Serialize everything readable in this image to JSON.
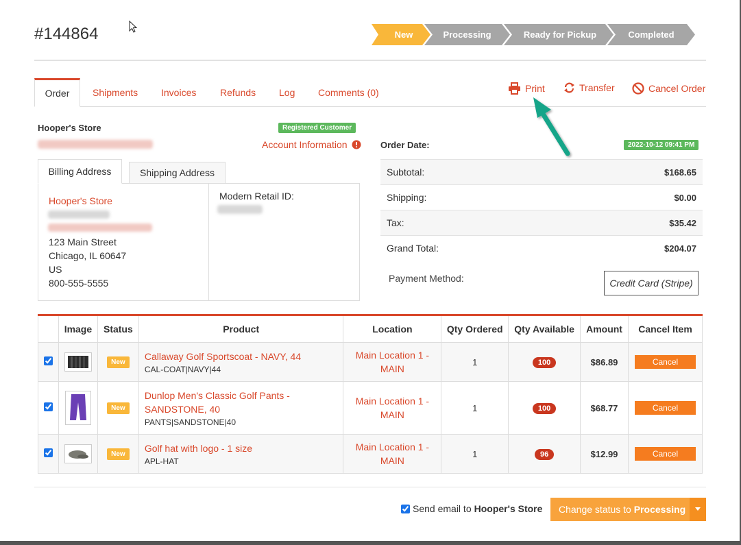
{
  "order": {
    "id": "#144864"
  },
  "steps": [
    {
      "label": "New",
      "state": "active",
      "color": "#f9b73a"
    },
    {
      "label": "Processing",
      "state": "pending",
      "color": "#a6a6a6"
    },
    {
      "label": "Ready for Pickup",
      "state": "pending",
      "color": "#a6a6a6"
    },
    {
      "label": "Completed",
      "state": "pending",
      "color": "#a6a6a6"
    }
  ],
  "tabs": [
    "Order",
    "Shipments",
    "Invoices",
    "Refunds",
    "Log",
    "Comments (0)"
  ],
  "actions": {
    "print": "Print",
    "transfer": "Transfer",
    "cancel": "Cancel Order"
  },
  "customer": {
    "store": "Hooper's Store",
    "badge": "Registered Customer",
    "account_info": "Account Information"
  },
  "address_tabs": [
    "Billing Address",
    "Shipping Address"
  ],
  "billing": {
    "name": "Hooper's Store",
    "street": "123 Main Street",
    "city": "Chicago, IL 60647",
    "country": "US",
    "phone": "800-555-5555",
    "retail_id_label": "Modern Retail ID:"
  },
  "summary": {
    "order_date_label": "Order Date:",
    "order_date": "2022-10-12 09:41 PM",
    "rows": [
      {
        "label": "Subtotal:",
        "value": "$168.65"
      },
      {
        "label": "Shipping:",
        "value": "$0.00"
      },
      {
        "label": "Tax:",
        "value": "$35.42"
      },
      {
        "label": "Grand Total:",
        "value": "$204.07"
      }
    ],
    "payment_label": "Payment Method:",
    "payment_value": "Credit Card (Stripe)"
  },
  "items_table": {
    "headers": [
      "",
      "Image",
      "Status",
      "Product",
      "Location",
      "Qty Ordered",
      "Qty Available",
      "Amount",
      "Cancel Item"
    ],
    "rows": [
      {
        "checked": true,
        "image": "sportscoat-thumbnail",
        "status": "New",
        "name": "Callaway Golf Sportscoat - NAVY, 44",
        "sku": "CAL-COAT|NAVY|44",
        "location": "Main Location 1 - MAIN",
        "qty_ordered": "1",
        "qty_available": "100",
        "amount": "$86.89",
        "cancel": "Cancel"
      },
      {
        "checked": true,
        "image": "pants-thumbnail",
        "status": "New",
        "name": "Dunlop Men's Classic Golf Pants - SANDSTONE, 40",
        "sku": "PANTS|SANDSTONE|40",
        "location": "Main Location 1 - MAIN",
        "qty_ordered": "1",
        "qty_available": "100",
        "amount": "$68.77",
        "cancel": "Cancel"
      },
      {
        "checked": true,
        "image": "hat-thumbnail",
        "status": "New",
        "name": "Golf hat with logo - 1 size",
        "sku": "APL-HAT",
        "location": "Main Location 1 - MAIN",
        "qty_ordered": "1",
        "qty_available": "96",
        "amount": "$12.99",
        "cancel": "Cancel"
      }
    ]
  },
  "footer": {
    "send_email_prefix": "Send email to",
    "send_email_target": "Hooper's Store",
    "send_email_checked": true,
    "status_button_prefix": "Change status to",
    "status_button_target": "Processing"
  },
  "colors": {
    "accent": "#d9482b",
    "orange": "#f8a33c",
    "green": "#5cb85c",
    "pointer_arrow": "#17a589"
  }
}
